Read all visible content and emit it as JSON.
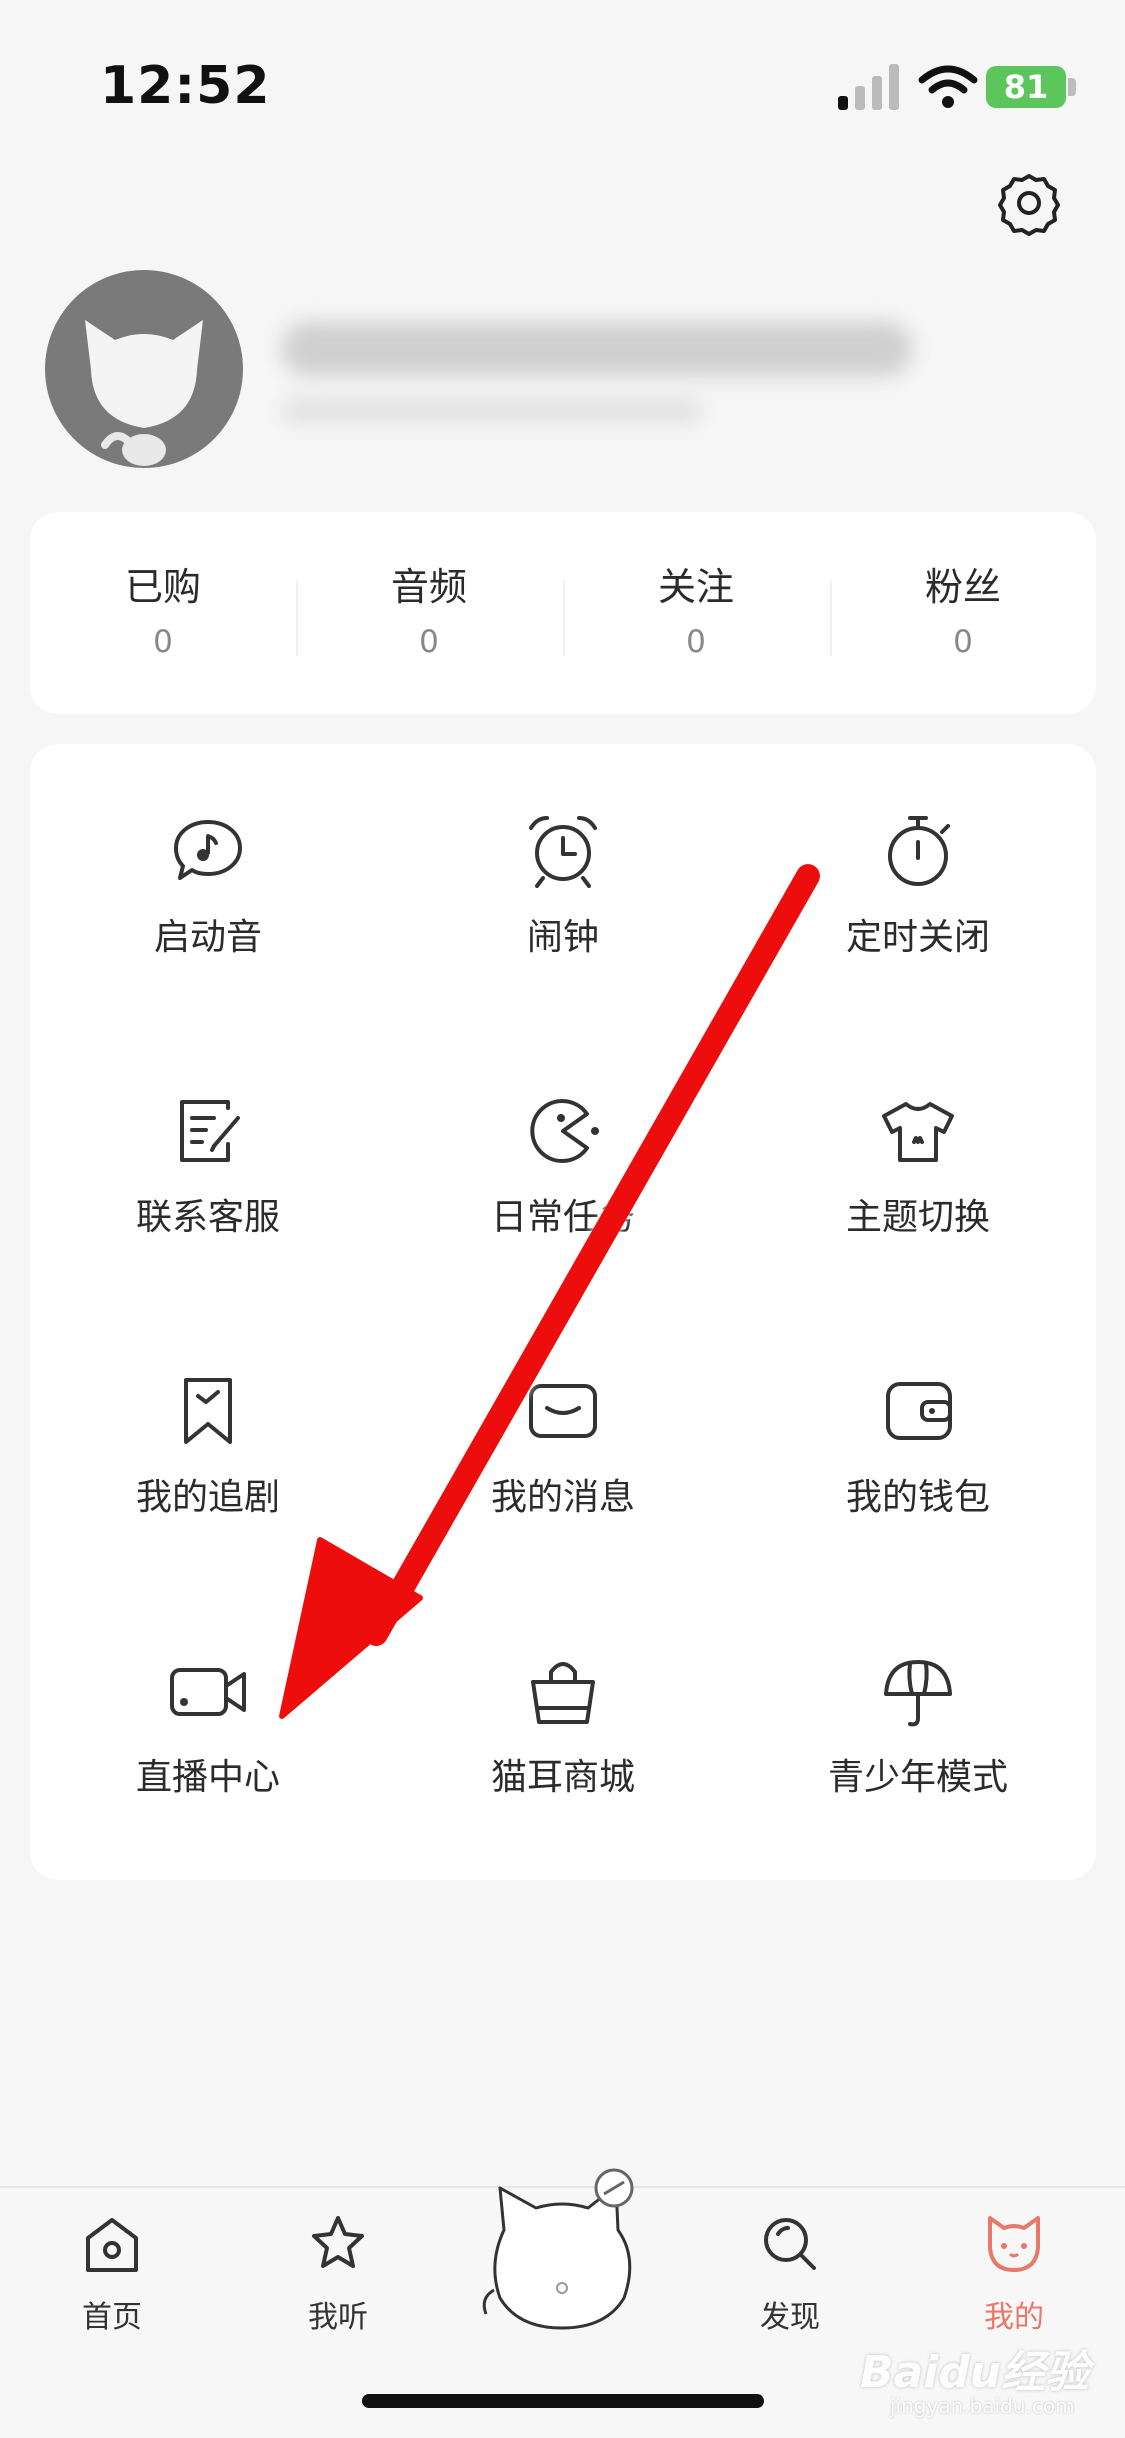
{
  "status_bar": {
    "time": "12:52",
    "battery": "81"
  },
  "stats": [
    {
      "label": "已购",
      "value": "0"
    },
    {
      "label": "音频",
      "value": "0"
    },
    {
      "label": "关注",
      "value": "0"
    },
    {
      "label": "粉丝",
      "value": "0"
    }
  ],
  "menu": [
    {
      "label": "启动音",
      "icon": "music-bubble-icon"
    },
    {
      "label": "闹钟",
      "icon": "alarm-clock-icon"
    },
    {
      "label": "定时关闭",
      "icon": "timer-icon"
    },
    {
      "label": "联系客服",
      "icon": "edit-note-icon"
    },
    {
      "label": "日常任务",
      "icon": "pacman-icon"
    },
    {
      "label": "主题切换",
      "icon": "tshirt-icon"
    },
    {
      "label": "我的追剧",
      "icon": "bookmark-icon"
    },
    {
      "label": "我的消息",
      "icon": "message-icon"
    },
    {
      "label": "我的钱包",
      "icon": "wallet-icon"
    },
    {
      "label": "直播中心",
      "icon": "video-camera-icon"
    },
    {
      "label": "猫耳商城",
      "icon": "shopping-bag-icon"
    },
    {
      "label": "青少年模式",
      "icon": "umbrella-icon"
    }
  ],
  "nav": [
    {
      "label": "首页",
      "icon": "home-icon"
    },
    {
      "label": "我听",
      "icon": "star-icon"
    },
    {
      "label": "发现",
      "icon": "search-icon"
    },
    {
      "label": "我的",
      "icon": "cat-face-icon"
    }
  ],
  "colors": {
    "accent": "#e8786a",
    "battery": "#5cc65c",
    "arrow": "#ee1111"
  },
  "watermark": {
    "brand": "Baidu经验",
    "url": "jingyan.baidu.com"
  }
}
